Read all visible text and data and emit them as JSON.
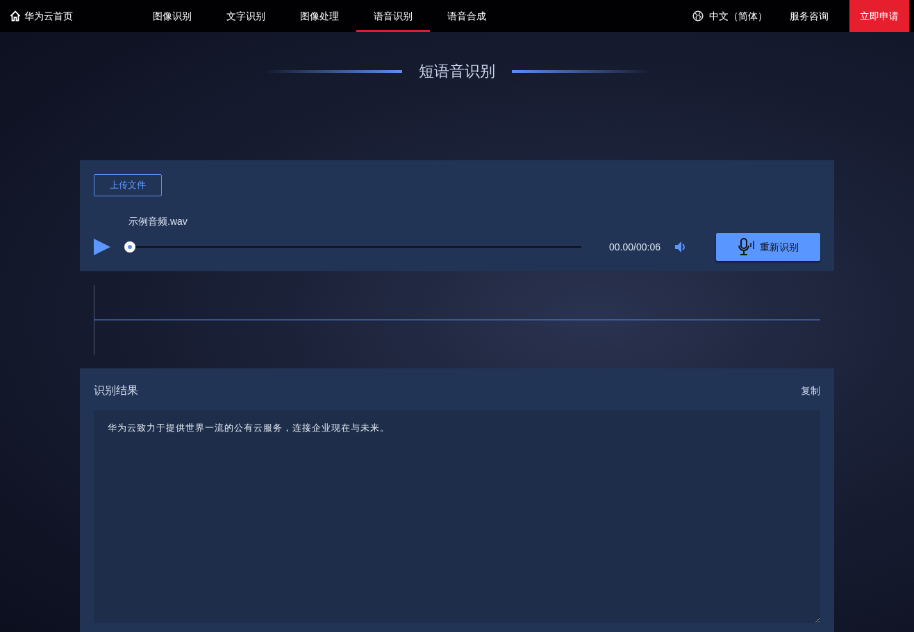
{
  "nav": {
    "home": "华为云首页",
    "tabs": [
      {
        "label": "图像识别",
        "selected": false
      },
      {
        "label": "文字识别",
        "selected": false
      },
      {
        "label": "图像处理",
        "selected": false
      },
      {
        "label": "语音识别",
        "selected": true
      },
      {
        "label": "语音合成",
        "selected": false
      }
    ],
    "language": "中文（简体）",
    "consult": "服务咨询",
    "apply": "立即申请"
  },
  "page_title": "短语音识别",
  "player": {
    "upload_button": "上传文件",
    "file_name": "示例音频.wav",
    "level": 0,
    "time": "00.00/00:06",
    "recognize_button": "重新识别"
  },
  "result": {
    "title": "识别结果",
    "copy": "复制",
    "text": "华为云致力于提供世界一流的公有云服务，连接企业现在与未来。"
  }
}
